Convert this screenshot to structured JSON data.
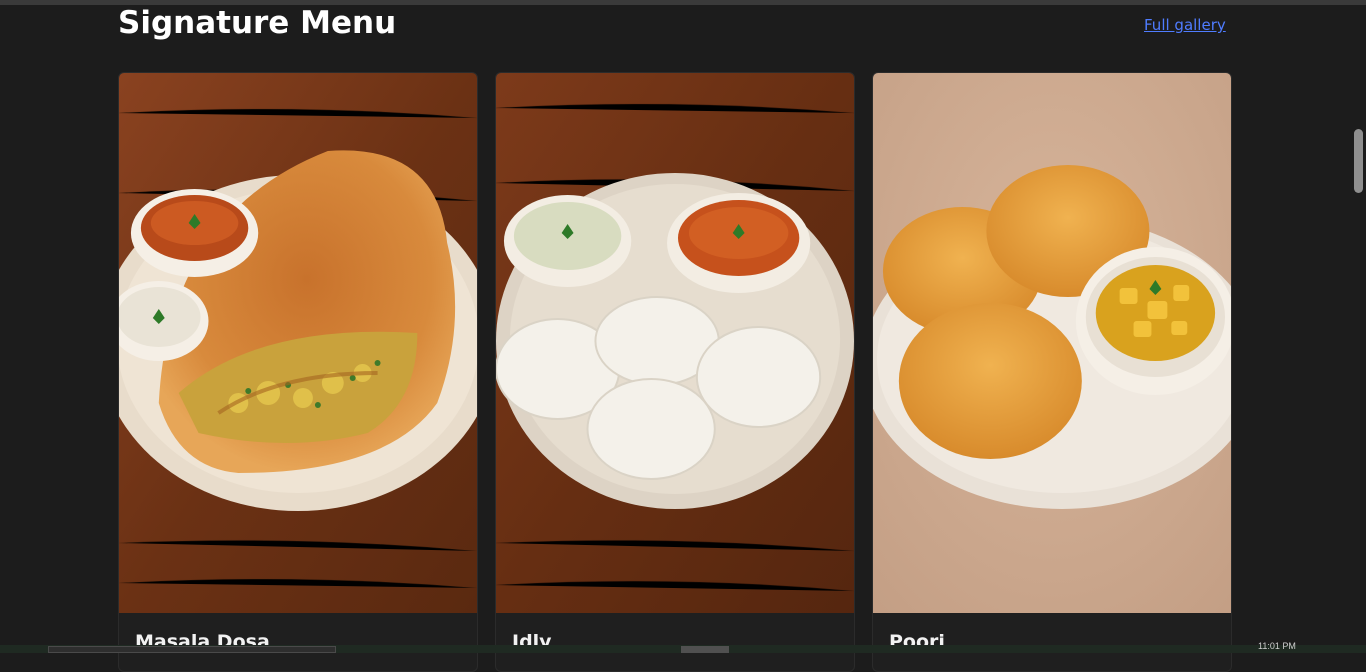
{
  "header": {
    "title": "Signature Menu",
    "link_label": "Full gallery"
  },
  "menu": {
    "items": [
      {
        "name": "Masala Dosa",
        "image_icon": "masala-dosa-photo"
      },
      {
        "name": "Idly",
        "image_icon": "idly-photo"
      },
      {
        "name": "Poori",
        "image_icon": "poori-photo"
      }
    ]
  },
  "taskbar": {
    "time": "11:01 PM"
  },
  "colors": {
    "background": "#1c1c1c",
    "link": "#4f7cff",
    "wood": "#7a3a18",
    "beige": "#c9a58a"
  }
}
